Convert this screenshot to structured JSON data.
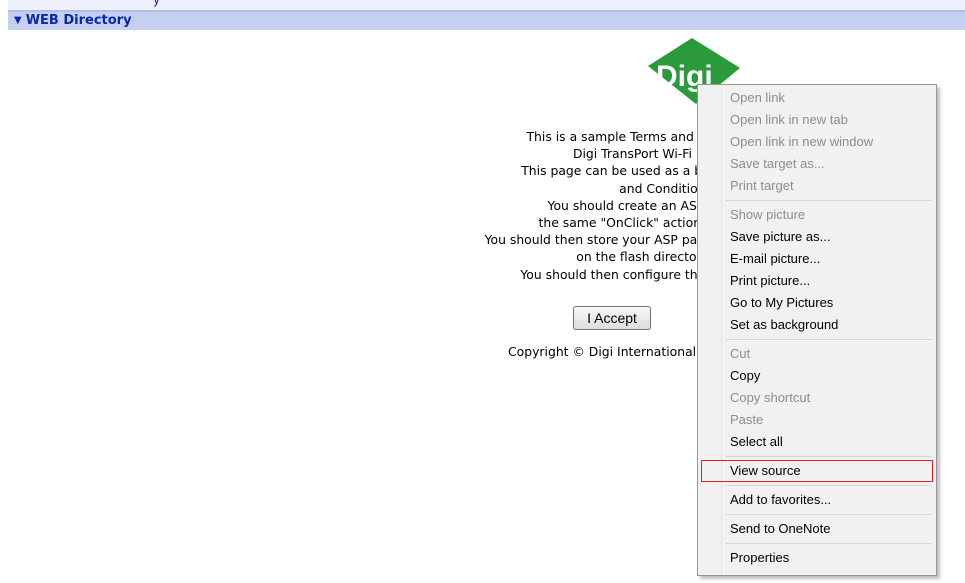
{
  "header": {
    "arrow_glyph": "▼",
    "title": "WEB Directory",
    "top_fragment": "y"
  },
  "logo": {
    "text": "Digi",
    "color": "#2a9a3a"
  },
  "terms": {
    "lines": [
      "This is a sample Terms and Conditions page for the",
      "Digi TransPort Wi-Fi Hotspot feature.",
      "This page can be used as a basis for your own Terms",
      "and Conditions page.",
      "You should create an ASP file which includes",
      "the same \"OnClick\" action as the button below.",
      "You should then store your ASP page (or any supporting images)",
      "on the flash directory of the router.",
      "You should then configure the Wi-Fi Hotspot to use it."
    ]
  },
  "accept_button": {
    "label": "I Accept"
  },
  "copyright": "Copyright © Digi International Inc.",
  "context_menu": {
    "items": [
      {
        "label": "Open link",
        "enabled": false
      },
      {
        "label": "Open link in new tab",
        "enabled": false
      },
      {
        "label": "Open link in new window",
        "enabled": false
      },
      {
        "label": "Save target as...",
        "enabled": false
      },
      {
        "label": "Print target",
        "enabled": false
      },
      {
        "separator": true
      },
      {
        "label": "Show picture",
        "enabled": false
      },
      {
        "label": "Save picture as...",
        "enabled": true
      },
      {
        "label": "E-mail picture...",
        "enabled": true
      },
      {
        "label": "Print picture...",
        "enabled": true
      },
      {
        "label": "Go to My Pictures",
        "enabled": true
      },
      {
        "label": "Set as background",
        "enabled": true
      },
      {
        "separator": true
      },
      {
        "label": "Cut",
        "enabled": false
      },
      {
        "label": "Copy",
        "enabled": true
      },
      {
        "label": "Copy shortcut",
        "enabled": false
      },
      {
        "label": "Paste",
        "enabled": false
      },
      {
        "label": "Select all",
        "enabled": true
      },
      {
        "separator": true
      },
      {
        "label": "View source",
        "enabled": true,
        "highlighted": true
      },
      {
        "separator": true
      },
      {
        "label": "Add to favorites...",
        "enabled": true
      },
      {
        "separator": true
      },
      {
        "label": "Send to OneNote",
        "enabled": true
      },
      {
        "separator": true
      },
      {
        "label": "Properties",
        "enabled": true
      }
    ]
  },
  "colors": {
    "header_bg": "#c5d0f0",
    "header_text": "#0a27a8",
    "menu_disabled": "#8d8d8d",
    "highlight_border": "#e02020"
  }
}
